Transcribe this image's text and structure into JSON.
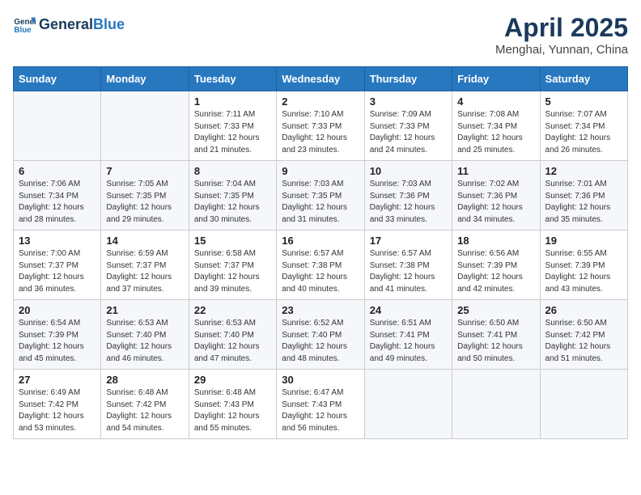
{
  "header": {
    "logo_general": "General",
    "logo_blue": "Blue",
    "month": "April 2025",
    "location": "Menghai, Yunnan, China"
  },
  "weekdays": [
    "Sunday",
    "Monday",
    "Tuesday",
    "Wednesday",
    "Thursday",
    "Friday",
    "Saturday"
  ],
  "weeks": [
    [
      {
        "day": "",
        "info": ""
      },
      {
        "day": "",
        "info": ""
      },
      {
        "day": "1",
        "info": "Sunrise: 7:11 AM\nSunset: 7:33 PM\nDaylight: 12 hours and 21 minutes."
      },
      {
        "day": "2",
        "info": "Sunrise: 7:10 AM\nSunset: 7:33 PM\nDaylight: 12 hours and 23 minutes."
      },
      {
        "day": "3",
        "info": "Sunrise: 7:09 AM\nSunset: 7:33 PM\nDaylight: 12 hours and 24 minutes."
      },
      {
        "day": "4",
        "info": "Sunrise: 7:08 AM\nSunset: 7:34 PM\nDaylight: 12 hours and 25 minutes."
      },
      {
        "day": "5",
        "info": "Sunrise: 7:07 AM\nSunset: 7:34 PM\nDaylight: 12 hours and 26 minutes."
      }
    ],
    [
      {
        "day": "6",
        "info": "Sunrise: 7:06 AM\nSunset: 7:34 PM\nDaylight: 12 hours and 28 minutes."
      },
      {
        "day": "7",
        "info": "Sunrise: 7:05 AM\nSunset: 7:35 PM\nDaylight: 12 hours and 29 minutes."
      },
      {
        "day": "8",
        "info": "Sunrise: 7:04 AM\nSunset: 7:35 PM\nDaylight: 12 hours and 30 minutes."
      },
      {
        "day": "9",
        "info": "Sunrise: 7:03 AM\nSunset: 7:35 PM\nDaylight: 12 hours and 31 minutes."
      },
      {
        "day": "10",
        "info": "Sunrise: 7:03 AM\nSunset: 7:36 PM\nDaylight: 12 hours and 33 minutes."
      },
      {
        "day": "11",
        "info": "Sunrise: 7:02 AM\nSunset: 7:36 PM\nDaylight: 12 hours and 34 minutes."
      },
      {
        "day": "12",
        "info": "Sunrise: 7:01 AM\nSunset: 7:36 PM\nDaylight: 12 hours and 35 minutes."
      }
    ],
    [
      {
        "day": "13",
        "info": "Sunrise: 7:00 AM\nSunset: 7:37 PM\nDaylight: 12 hours and 36 minutes."
      },
      {
        "day": "14",
        "info": "Sunrise: 6:59 AM\nSunset: 7:37 PM\nDaylight: 12 hours and 37 minutes."
      },
      {
        "day": "15",
        "info": "Sunrise: 6:58 AM\nSunset: 7:37 PM\nDaylight: 12 hours and 39 minutes."
      },
      {
        "day": "16",
        "info": "Sunrise: 6:57 AM\nSunset: 7:38 PM\nDaylight: 12 hours and 40 minutes."
      },
      {
        "day": "17",
        "info": "Sunrise: 6:57 AM\nSunset: 7:38 PM\nDaylight: 12 hours and 41 minutes."
      },
      {
        "day": "18",
        "info": "Sunrise: 6:56 AM\nSunset: 7:39 PM\nDaylight: 12 hours and 42 minutes."
      },
      {
        "day": "19",
        "info": "Sunrise: 6:55 AM\nSunset: 7:39 PM\nDaylight: 12 hours and 43 minutes."
      }
    ],
    [
      {
        "day": "20",
        "info": "Sunrise: 6:54 AM\nSunset: 7:39 PM\nDaylight: 12 hours and 45 minutes."
      },
      {
        "day": "21",
        "info": "Sunrise: 6:53 AM\nSunset: 7:40 PM\nDaylight: 12 hours and 46 minutes."
      },
      {
        "day": "22",
        "info": "Sunrise: 6:53 AM\nSunset: 7:40 PM\nDaylight: 12 hours and 47 minutes."
      },
      {
        "day": "23",
        "info": "Sunrise: 6:52 AM\nSunset: 7:40 PM\nDaylight: 12 hours and 48 minutes."
      },
      {
        "day": "24",
        "info": "Sunrise: 6:51 AM\nSunset: 7:41 PM\nDaylight: 12 hours and 49 minutes."
      },
      {
        "day": "25",
        "info": "Sunrise: 6:50 AM\nSunset: 7:41 PM\nDaylight: 12 hours and 50 minutes."
      },
      {
        "day": "26",
        "info": "Sunrise: 6:50 AM\nSunset: 7:42 PM\nDaylight: 12 hours and 51 minutes."
      }
    ],
    [
      {
        "day": "27",
        "info": "Sunrise: 6:49 AM\nSunset: 7:42 PM\nDaylight: 12 hours and 53 minutes."
      },
      {
        "day": "28",
        "info": "Sunrise: 6:48 AM\nSunset: 7:42 PM\nDaylight: 12 hours and 54 minutes."
      },
      {
        "day": "29",
        "info": "Sunrise: 6:48 AM\nSunset: 7:43 PM\nDaylight: 12 hours and 55 minutes."
      },
      {
        "day": "30",
        "info": "Sunrise: 6:47 AM\nSunset: 7:43 PM\nDaylight: 12 hours and 56 minutes."
      },
      {
        "day": "",
        "info": ""
      },
      {
        "day": "",
        "info": ""
      },
      {
        "day": "",
        "info": ""
      }
    ]
  ]
}
